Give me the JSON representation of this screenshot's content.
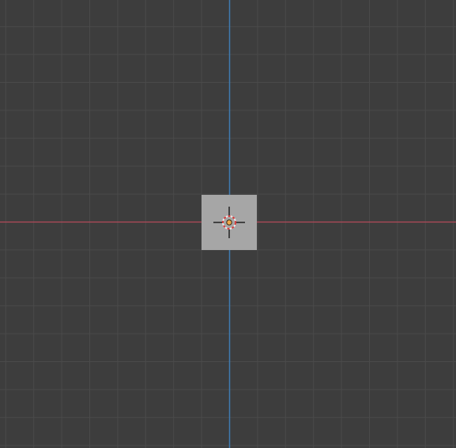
{
  "viewport": {
    "mode": "orthographic-top",
    "background_color": "#3d3d3d",
    "grid_color": "#4a4a4a",
    "x_axis_color": "#b34a5a",
    "y_axis_color": "#3f7bb0"
  },
  "object": {
    "type": "plane",
    "state": "selected",
    "fill_color": "#a6a6a6"
  },
  "cursor": {
    "icon": "3d-cursor-icon",
    "ring_color_a": "#e8e8e8",
    "ring_color_b": "#d43a3a",
    "crosshair_color": "#000000"
  },
  "origin": {
    "icon": "object-origin-icon",
    "color": "#f2a84a"
  }
}
